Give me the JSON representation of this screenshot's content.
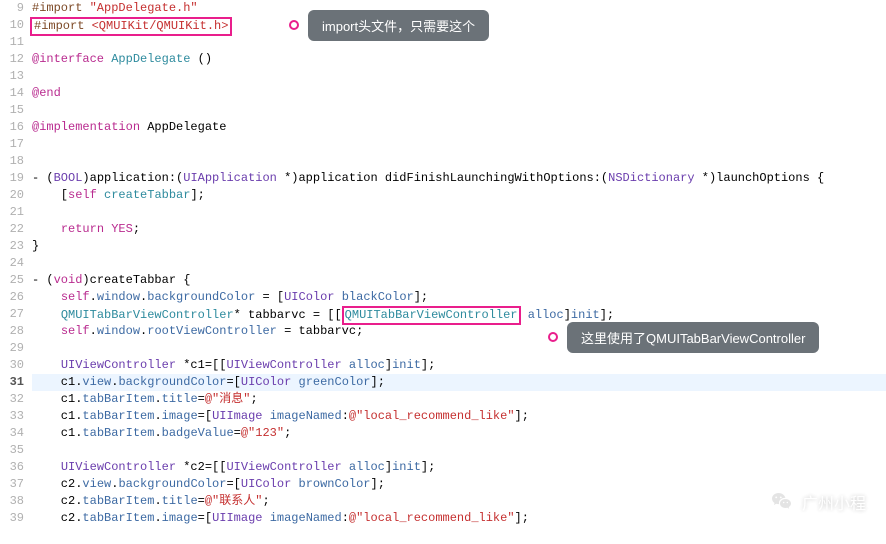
{
  "callouts": {
    "top": "import头文件，只需要这个",
    "mid": "这里使用了QMUITabBarViewController"
  },
  "watermark": "广州小程",
  "gutter": [
    "9",
    "10",
    "11",
    "12",
    "13",
    "14",
    "15",
    "16",
    "17",
    "18",
    "19",
    "20",
    "21",
    "22",
    "23",
    "24",
    "25",
    "26",
    "27",
    "28",
    "29",
    "30",
    "31",
    "32",
    "33",
    "34",
    "35",
    "36",
    "37",
    "38",
    "39"
  ],
  "current_line_index": 22,
  "code": {
    "l9": {
      "a": "#import ",
      "b": "\"AppDelegate.h\""
    },
    "l10": {
      "a": "#import ",
      "b": "<QMUIKit/QMUIKit.h>"
    },
    "l12": {
      "a": "@interface ",
      "b": "AppDelegate",
      "c": " ()"
    },
    "l14": {
      "a": "@end"
    },
    "l16": {
      "a": "@implementation ",
      "b": "AppDelegate"
    },
    "l19": {
      "a": "- (",
      "b": "BOOL",
      "c": ")application:(",
      "d": "UIApplication",
      "e": " *)application didFinishLaunchingWithOptions:(",
      "f": "NSDictionary",
      "g": " *)launchOptions {"
    },
    "l20": {
      "a": "    [",
      "b": "self",
      "c": " ",
      "d": "createTabbar",
      "e": "];"
    },
    "l22": {
      "a": "    ",
      "b": "return",
      "c": " ",
      "d": "YES",
      "e": ";"
    },
    "l23": {
      "a": "}"
    },
    "l25": {
      "a": "- (",
      "b": "void",
      "c": ")createTabbar {"
    },
    "l26": {
      "a": "    ",
      "b": "self",
      "c": ".",
      "d": "window",
      "e": ".",
      "f": "backgroundColor",
      "g": " = [",
      "h": "UIColor",
      "i": " ",
      "j": "blackColor",
      "k": "];"
    },
    "l27": {
      "a": "    ",
      "b": "QMUITabBarViewController",
      "c": "* tabbarvc = [[",
      "d": "QMUITabBarViewController",
      "e": " ",
      "f": "alloc",
      "g": "]",
      "h": "init",
      "i": "];"
    },
    "l28": {
      "a": "    ",
      "b": "self",
      "c": ".",
      "d": "window",
      "e": ".",
      "f": "rootViewController",
      "g": " = tabbarvc;"
    },
    "l30": {
      "a": "    ",
      "b": "UIViewController",
      "c": " *c1=[[",
      "d": "UIViewController",
      "e": " ",
      "f": "alloc",
      "g": "]",
      "h": "init",
      "i": "];"
    },
    "l31": {
      "a": "    c1.",
      "b": "view",
      "c": ".",
      "d": "backgroundColor",
      "e": "=[",
      "f": "UIColor",
      "g": " ",
      "h": "greenColor",
      "i": "];"
    },
    "l32": {
      "a": "    c1.",
      "b": "tabBarItem",
      "c": ".",
      "d": "title",
      "e": "=",
      "f": "@\"消息\"",
      "g": ";"
    },
    "l33": {
      "a": "    c1.",
      "b": "tabBarItem",
      "c": ".",
      "d": "image",
      "e": "=[",
      "f": "UIImage",
      "g": " ",
      "h": "imageNamed",
      "i": ":",
      "j": "@\"local_recommend_like\"",
      "k": "];"
    },
    "l34": {
      "a": "    c1.",
      "b": "tabBarItem",
      "c": ".",
      "d": "badgeValue",
      "e": "=",
      "f": "@\"123\"",
      "g": ";"
    },
    "l36": {
      "a": "    ",
      "b": "UIViewController",
      "c": " *c2=[[",
      "d": "UIViewController",
      "e": " ",
      "f": "alloc",
      "g": "]",
      "h": "init",
      "i": "];"
    },
    "l37": {
      "a": "    c2.",
      "b": "view",
      "c": ".",
      "d": "backgroundColor",
      "e": "=[",
      "f": "UIColor",
      "g": " ",
      "h": "brownColor",
      "i": "];"
    },
    "l38": {
      "a": "    c2.",
      "b": "tabBarItem",
      "c": ".",
      "d": "title",
      "e": "=",
      "f": "@\"联系人\"",
      "g": ";"
    },
    "l39": {
      "a": "    c2.",
      "b": "tabBarItem",
      "c": ".",
      "d": "image",
      "e": "=[",
      "f": "UIImage",
      "g": " ",
      "h": "imageNamed",
      "i": ":",
      "j": "@\"local_recommend_like\"",
      "k": "];"
    }
  }
}
